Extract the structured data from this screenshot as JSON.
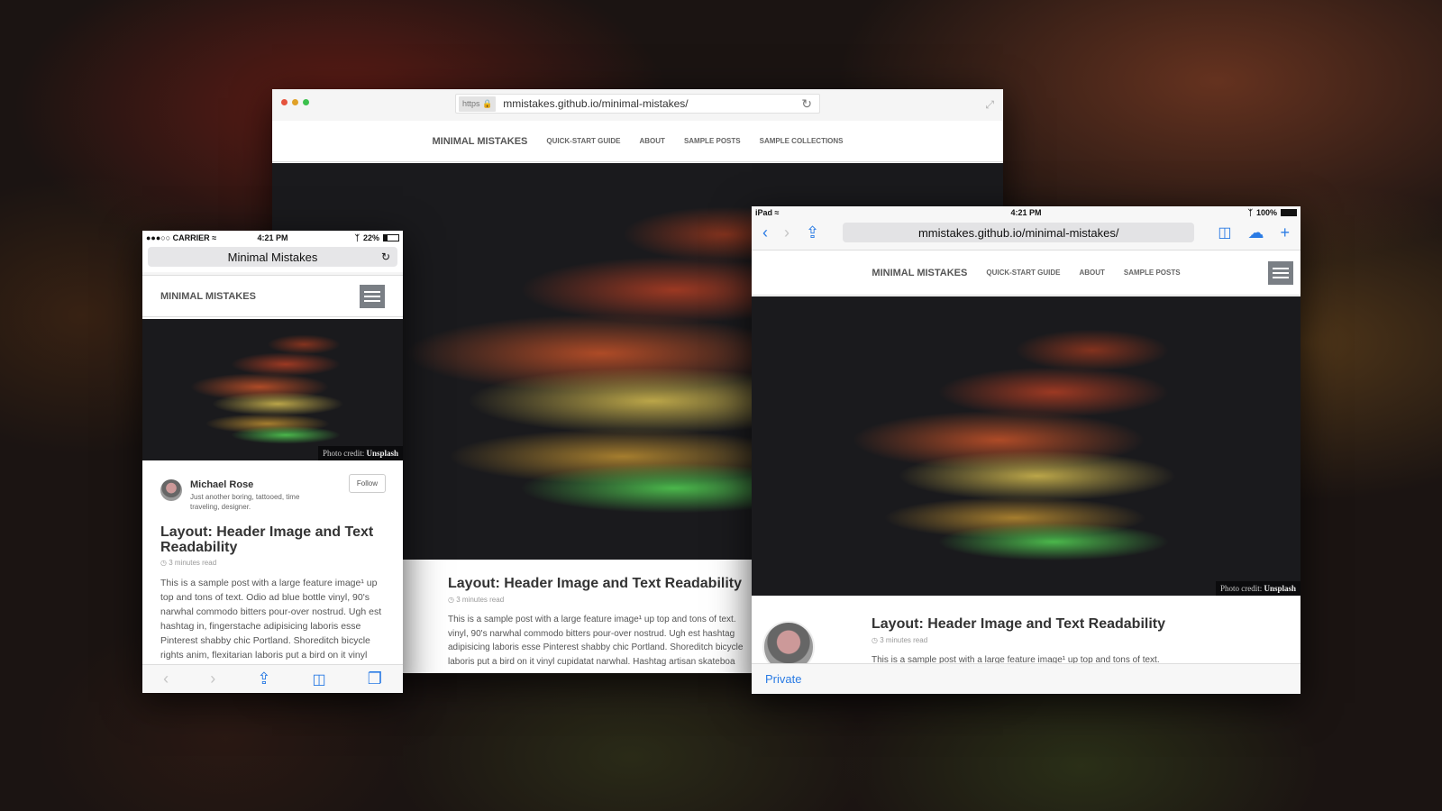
{
  "colors": {
    "ios_blue": "#2a7be4",
    "traffic_red": "#e5533d",
    "traffic_yellow": "#e0a128",
    "traffic_green": "#3cc14d",
    "hamburger_bg": "#7a7f85"
  },
  "site": {
    "brand": "MINIMAL MISTAKES",
    "nav_links": [
      "QUICK-START GUIDE",
      "ABOUT",
      "SAMPLE POSTS",
      "SAMPLE COLLECTIONS"
    ],
    "photo_credit_label": "Photo credit:",
    "photo_credit_source": "Unsplash",
    "post": {
      "title": "Layout: Header Image and Text Readability",
      "read_time": "3 minutes read",
      "body_lines_desktop": [
        "This is a sample post with a large feature image¹ up top and tons of text.",
        "vinyl, 90's narwhal commodo bitters pour-over nostrud. Ugh est hashtag",
        "adipisicing laboris esse Pinterest shabby chic Portland. Shoreditch bicycle",
        "laboris put a bird on it vinyl cupidatat narwhal. Hashtag artisan skateboa"
      ],
      "body_phone": "This is a sample post with a large feature image¹ up top and tons of text. Odio ad blue bottle vinyl, 90's narwhal commodo bitters pour-over nostrud. Ugh est hashtag in, fingerstache adipisicing laboris esse Pinterest shabby chic Portland. Shoreditch bicycle rights anim, flexitarian laboris put a bird on it vinyl",
      "body_tablet": "This is a sample post with a large feature image¹ up top and tons of text."
    },
    "author": {
      "name": "Michael Rose",
      "bio": "Just another boring, tattooed, time traveling, designer.",
      "follow_label": "Follow"
    }
  },
  "desktop": {
    "scheme": "https",
    "url": "mmistakes.github.io/minimal-mistakes/",
    "reload_icon": "↻",
    "expand_icon": "⤢"
  },
  "phone": {
    "carrier": "●●●○○ CARRIER",
    "time": "4:21 PM",
    "battery": "22%",
    "battery_level": 0.22,
    "address_title": "Minimal Mistakes",
    "reload_icon": "↻",
    "toolbar": {
      "back": "‹",
      "forward": "›",
      "share": "⇪",
      "bookmarks": "📖",
      "tabs": "❐"
    }
  },
  "tablet": {
    "device": "iPad",
    "time": "4:21 PM",
    "battery": "100%",
    "battery_level": 1.0,
    "url": "mmistakes.github.io/minimal-mistakes/",
    "nav_links": [
      "QUICK-START GUIDE",
      "ABOUT",
      "SAMPLE POSTS"
    ],
    "toolbar": {
      "back": "‹",
      "forward": "›",
      "share": "⇪",
      "bookmarks": "📖",
      "cloud": "☁",
      "add": "+"
    },
    "private_label": "Private"
  }
}
